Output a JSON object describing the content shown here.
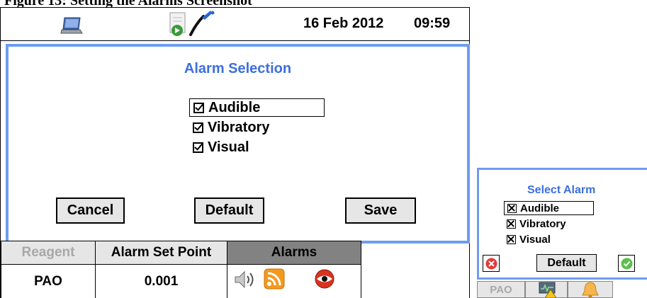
{
  "caption": "Figure 13: Setting the Alarms Screenshot",
  "status_bar": {
    "date": "16 Feb 2012",
    "time": "09:59",
    "icons": [
      "laptop-icon",
      "document-icon",
      "pen-icon"
    ]
  },
  "dialog": {
    "title": "Alarm Selection",
    "options": [
      {
        "label": "Audible",
        "checked": true,
        "focused": true
      },
      {
        "label": "Vibratory",
        "checked": true
      },
      {
        "label": "Visual",
        "checked": true
      }
    ],
    "buttons": {
      "cancel": "Cancel",
      "default": "Default",
      "save": "Save"
    }
  },
  "table": {
    "headers": [
      "Reagent",
      "Alarm Set Point",
      "Alarms"
    ],
    "row": {
      "reagent": "PAO",
      "set_point": "0.001",
      "alarm_icons": [
        "speaker-icon",
        "rss-icon",
        "eye-icon"
      ]
    }
  },
  "mini_panel": {
    "title": "Select Alarm",
    "options": [
      {
        "label": "Audible",
        "checked": true,
        "focused": true
      },
      {
        "label": "Vibratory",
        "checked": true
      },
      {
        "label": "Visual",
        "checked": true
      }
    ],
    "default_label": "Default",
    "tabs": {
      "reagent": "PAO",
      "icons": [
        "monitor-warning-icon",
        "bell-icon"
      ]
    }
  },
  "colors": {
    "accent_border": "#6e9cf2",
    "title_blue": "#3a6fe0",
    "button_gray": "#e6e6e6",
    "header_dark": "#828282"
  }
}
